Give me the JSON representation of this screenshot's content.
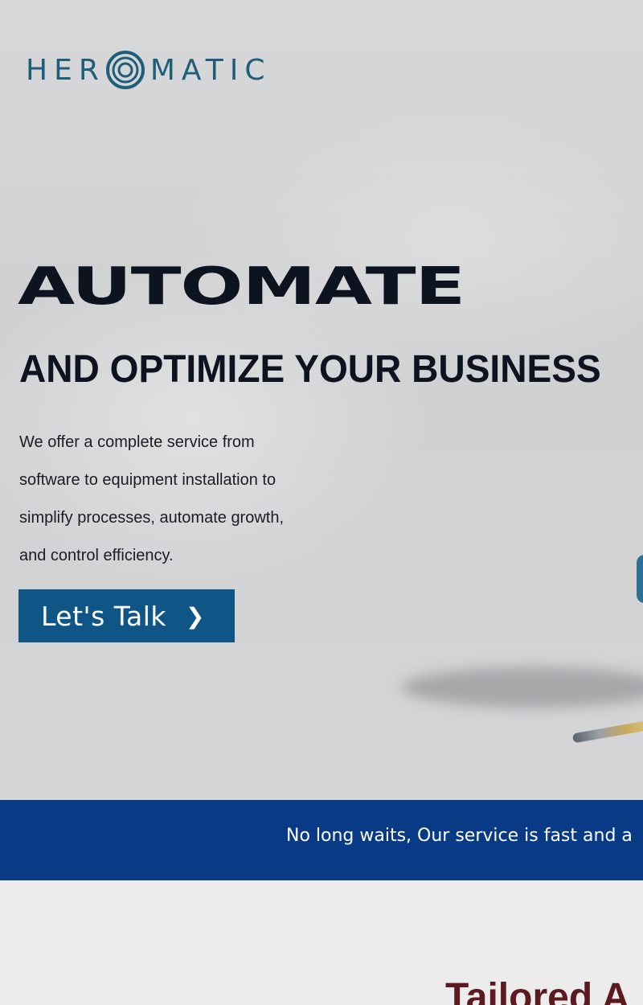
{
  "brand": {
    "logo_text_left": "HER",
    "logo_text_right": "MATIC",
    "logo_mark": "concentric-circle-logo-icon"
  },
  "hero": {
    "headline": "AUTOMATE",
    "subheadline": "AND OPTIMIZE YOUR BUSINESS",
    "intro_lines": [
      "We offer a complete service from",
      "software to equipment installation to",
      "simplify processes, automate growth,",
      "and control efficiency."
    ],
    "cta_label": "Let's Talk",
    "cta_icon": "chevron-right-icon"
  },
  "banner": {
    "text": "No long waits, Our service is fast and a"
  },
  "section": {
    "heading": "Tailored A"
  },
  "colors": {
    "brand_teal": "#1f5e78",
    "cta_blue": "#0f5687",
    "banner_blue": "#093a86",
    "heading_dark": "#0e1320",
    "section_heading_maroon": "#5a1a20"
  }
}
